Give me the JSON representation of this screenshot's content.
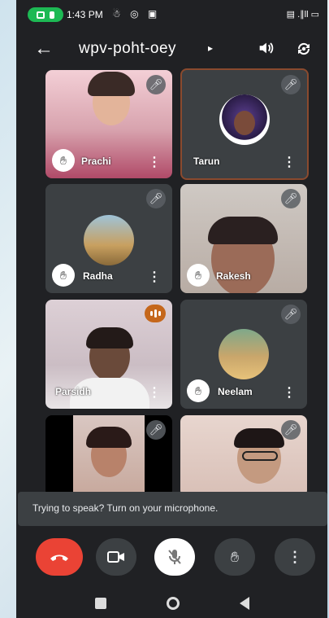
{
  "status_bar": {
    "time": "1:43 PM",
    "left_icons": "☃ ◎ ▣",
    "right_icons": "▤ .∥ll ▭"
  },
  "header": {
    "meeting_code": "wpv-poht-oey",
    "back_icon": "arrow-left-icon",
    "caret": "▸"
  },
  "participants": [
    {
      "name": "Prachi",
      "muted": true,
      "hand_raised": true,
      "video": true
    },
    {
      "name": "Tarun",
      "muted": true,
      "hand_raised": false,
      "video": false,
      "active": true
    },
    {
      "name": "Radha",
      "muted": true,
      "hand_raised": true,
      "video": false
    },
    {
      "name": "Rakesh",
      "muted": true,
      "hand_raised": true,
      "video": true
    },
    {
      "name": "Parsidh",
      "muted": false,
      "speaking": true,
      "hand_raised": false,
      "video": true
    },
    {
      "name": "Neelam",
      "muted": true,
      "hand_raised": true,
      "video": false
    },
    {
      "name": "",
      "muted": true,
      "video": true
    },
    {
      "name": "",
      "muted": true,
      "video": true
    }
  ],
  "toast": {
    "message": "Trying to speak? Turn on your microphone."
  },
  "controls": {
    "end_call": "end-call-icon",
    "camera": "camera-icon",
    "mic": "mic-off-icon",
    "hand": "hand-icon",
    "more": "more-vert-icon"
  },
  "colors": {
    "end_call": "#ea4335",
    "speaking": "#c5671b",
    "active_border": "#8a4a2e"
  }
}
